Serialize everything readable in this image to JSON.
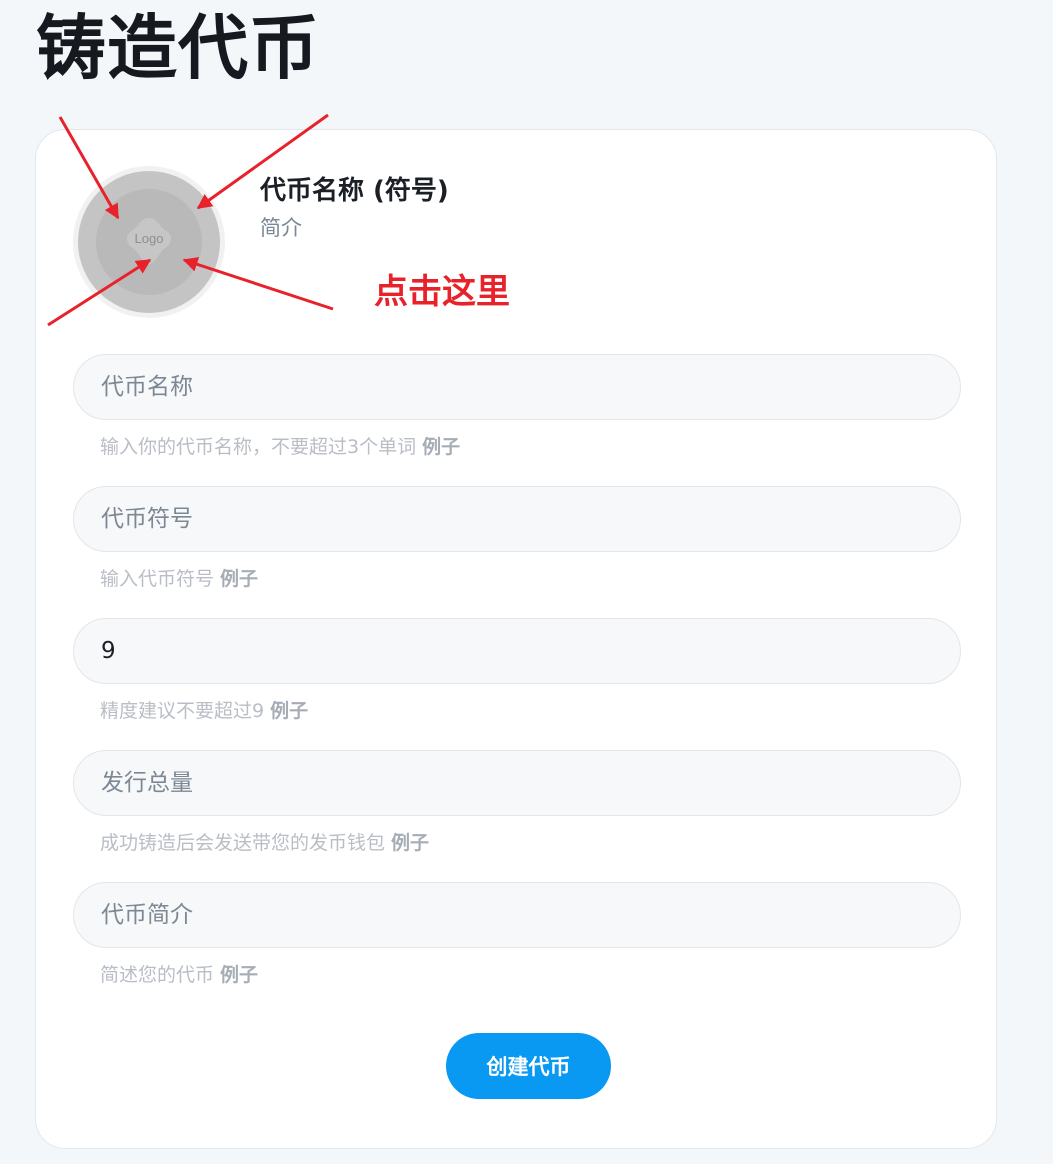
{
  "page": {
    "title": "铸造代币"
  },
  "token_card": {
    "logo_text": "Logo",
    "name_heading": "代币名称 (符号)",
    "subtitle": "简介",
    "click_hint": "点击这里",
    "annotation_color": "#e8222b"
  },
  "form": {
    "fields": [
      {
        "placeholder": "代币名称",
        "value": "",
        "hint": "输入你的代币名称，不要超过3个单词",
        "example_label": "例子"
      },
      {
        "placeholder": "代币符号",
        "value": "",
        "hint": "输入代币符号",
        "example_label": "例子"
      },
      {
        "placeholder": "",
        "value": "9",
        "hint": "精度建议不要超过9",
        "example_label": "例子"
      },
      {
        "placeholder": "发行总量",
        "value": "",
        "hint": "成功铸造后会发送带您的发币钱包",
        "example_label": "例子"
      },
      {
        "placeholder": "代币简介",
        "value": "",
        "hint": "简述您的代币",
        "example_label": "例子"
      }
    ],
    "submit_label": "创建代币",
    "accent_color": "#0a99f2"
  }
}
